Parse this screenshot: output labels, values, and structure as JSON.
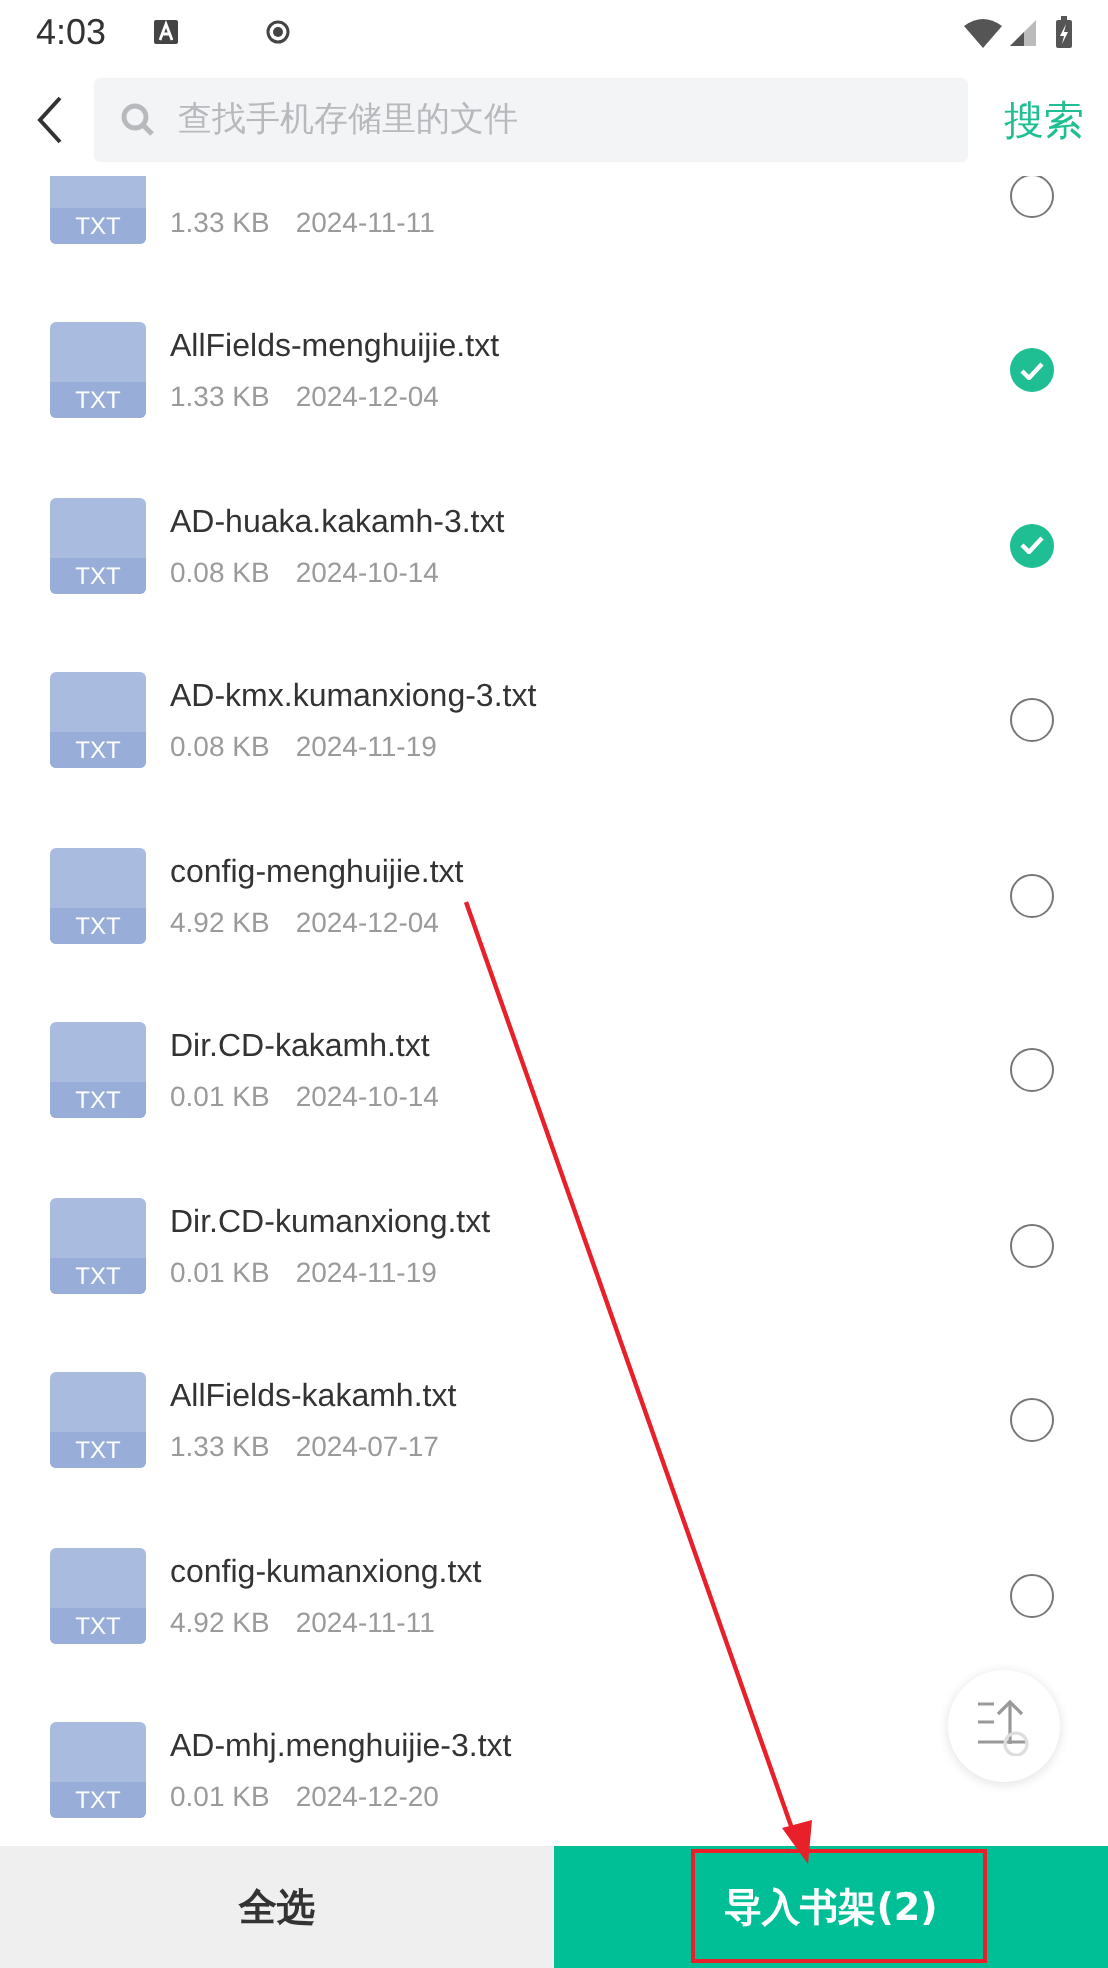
{
  "status_bar": {
    "time": "4:03"
  },
  "search": {
    "placeholder": "查找手机存储里的文件",
    "action": "搜索"
  },
  "files": [
    {
      "type_label": "TXT",
      "size": "1.33 KB",
      "date": "2024-11-11",
      "checked": false
    },
    {
      "name": "AllFields-menghuijie.txt",
      "type_label": "TXT",
      "size": "1.33 KB",
      "date": "2024-12-04",
      "checked": true
    },
    {
      "name": "AD-huaka.kakamh-3.txt",
      "type_label": "TXT",
      "size": "0.08 KB",
      "date": "2024-10-14",
      "checked": true
    },
    {
      "name": "AD-kmx.kumanxiong-3.txt",
      "type_label": "TXT",
      "size": "0.08 KB",
      "date": "2024-11-19",
      "checked": false
    },
    {
      "name": "config-menghuijie.txt",
      "type_label": "TXT",
      "size": "4.92 KB",
      "date": "2024-12-04",
      "checked": false
    },
    {
      "name": "Dir.CD-kakamh.txt",
      "type_label": "TXT",
      "size": "0.01 KB",
      "date": "2024-10-14",
      "checked": false
    },
    {
      "name": "Dir.CD-kumanxiong.txt",
      "type_label": "TXT",
      "size": "0.01 KB",
      "date": "2024-11-19",
      "checked": false
    },
    {
      "name": "AllFields-kakamh.txt",
      "type_label": "TXT",
      "size": "1.33 KB",
      "date": "2024-07-17",
      "checked": false
    },
    {
      "name": "config-kumanxiong.txt",
      "type_label": "TXT",
      "size": "4.92 KB",
      "date": "2024-11-11",
      "checked": false
    },
    {
      "name": "AD-mhj.menghuijie-3.txt",
      "type_label": "TXT",
      "size": "0.01 KB",
      "date": "2024-12-20"
    }
  ],
  "bottom_bar": {
    "select_all": "全选",
    "import": "导入书架(2)"
  }
}
